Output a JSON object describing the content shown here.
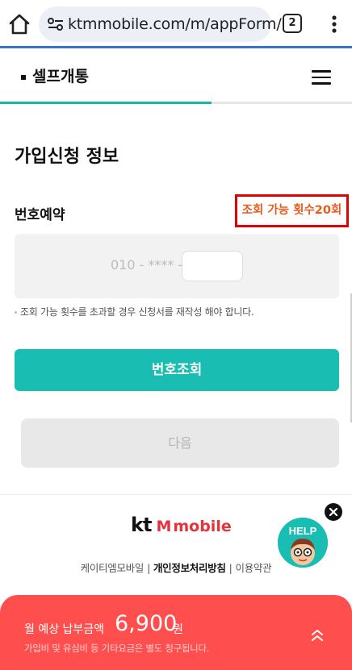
{
  "browser": {
    "url": "ktmmobile.com/m/appForm/",
    "tab_count": "2"
  },
  "header": {
    "title": "셀프개통",
    "progress": 0.6
  },
  "form": {
    "section_title": "가입신청 정보",
    "field_label": "번호예약",
    "lookup_count_text": "조회 가능 횟수20회",
    "number_prefix": "010 - **** -",
    "number_value": "",
    "notice": "조회 가능 횟수를 초과할 경우 신청서를 재작성 해야 합니다.",
    "lookup_button": "번호조회",
    "next_button": "다음"
  },
  "footer": {
    "logo_kt": "kt",
    "logo_m": "M",
    "logo_mobile": "mobile",
    "link_company": "케이티엠모바일",
    "link_privacy": "개인정보처리방침",
    "link_terms": "이용약관",
    "separator": "|",
    "help_label": "HELP"
  },
  "fee_panel": {
    "label": "월 예상 납부금액",
    "amount": "6,900",
    "unit": "원",
    "note": "가입비 및 유심비 등 기타요금은 별도 청구됩니다."
  },
  "colors": {
    "accent": "#19bdb1",
    "highlight_border": "#e20000",
    "highlight_text": "#e85a1d",
    "fee_panel": "#ff4e4e",
    "brand_red": "#e6323a"
  },
  "icons": {
    "home": "home-icon",
    "site_info": "site-info-icon",
    "menu": "more-vert-icon",
    "hamburger": "hamburger-menu-icon",
    "close": "close-icon",
    "expand": "chevron-double-up-icon"
  }
}
